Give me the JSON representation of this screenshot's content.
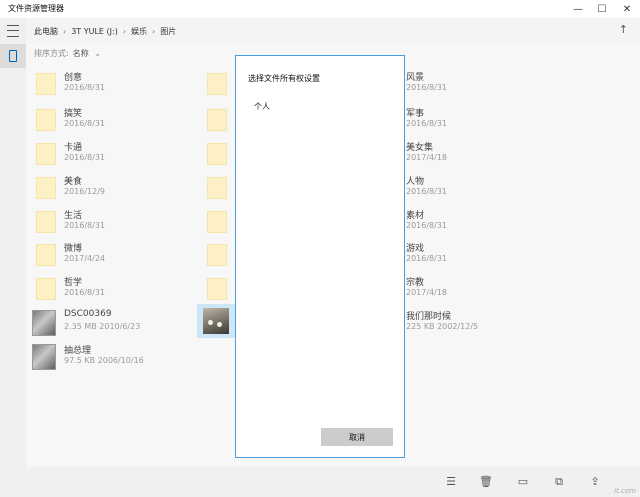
{
  "window": {
    "title": "文件资源管理器"
  },
  "header": {
    "breadcrumbs": [
      "此电脑",
      "3T YULE (J:)",
      "娱乐",
      "图片"
    ],
    "sort_label": "排序方式:",
    "sort_value": "名称",
    "up_icon": "up-arrow-icon"
  },
  "items": [
    {
      "type": "folder",
      "name": "创意",
      "meta": "2016/8/31"
    },
    {
      "type": "folder",
      "name": "搞笑",
      "meta": "2016/8/31"
    },
    {
      "type": "folder",
      "name": "卡通",
      "meta": "2016/8/31"
    },
    {
      "type": "folder",
      "name": "美食",
      "meta": "2016/12/9"
    },
    {
      "type": "folder",
      "name": "生活",
      "meta": "2016/8/31"
    },
    {
      "type": "folder",
      "name": "微博",
      "meta": "2017/4/24"
    },
    {
      "type": "folder",
      "name": "哲学",
      "meta": "2016/8/31"
    },
    {
      "type": "photo",
      "name": "DSC00369",
      "meta": "2.35 MB 2010/6/23"
    },
    {
      "type": "photo",
      "name": "抽总理",
      "meta": "97.5 KB 2006/10/16"
    },
    {
      "type": "folder",
      "name": "风景",
      "meta": "2016/8/31"
    },
    {
      "type": "folder",
      "name": "军事",
      "meta": "2016/8/31"
    },
    {
      "type": "folder",
      "name": "美女集",
      "meta": "2017/4/18"
    },
    {
      "type": "folder",
      "name": "人物",
      "meta": "2016/8/31"
    },
    {
      "type": "folder",
      "name": "素材",
      "meta": "2016/8/31"
    },
    {
      "type": "folder",
      "name": "游戏",
      "meta": "2016/8/31"
    },
    {
      "type": "folder",
      "name": "宗教",
      "meta": "2017/4/18"
    },
    {
      "type": "photo",
      "name": "我们那时候",
      "meta": "225 KB 2002/12/5"
    }
  ],
  "dialog": {
    "title": "选择文件所有权设置",
    "option": "个人",
    "cancel_label": "取消"
  },
  "bottom_toolbar": [
    "list-view-icon",
    "delete-icon",
    "new-file-icon",
    "copy-icon",
    "share-icon"
  ],
  "watermark": "it.com",
  "colors": {
    "accent": "#0063b1",
    "dialog_border": "#4a9ee0",
    "selection": "#cde6f7",
    "folder": "#fdf0c4"
  }
}
